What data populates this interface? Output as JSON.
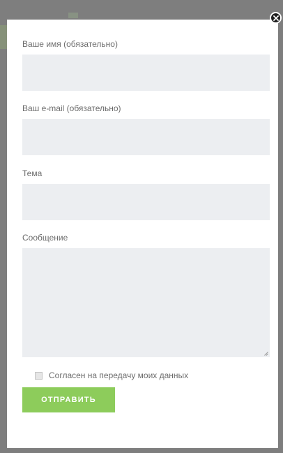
{
  "form": {
    "fields": [
      {
        "label": "Ваше имя (обязательно)",
        "value": "",
        "placeholder": ""
      },
      {
        "label": "Ваш e-mail (обязательно)",
        "value": "",
        "placeholder": ""
      },
      {
        "label": "Тема",
        "value": "",
        "placeholder": ""
      },
      {
        "label": "Сообщение",
        "value": "",
        "placeholder": ""
      }
    ],
    "consent_label": "Согласен на передачу моих данных",
    "consent_checked": false,
    "submit_label": "ОТПРАВИТЬ"
  },
  "colors": {
    "overlay": "#7e7e7e",
    "modal_bg": "#ffffff",
    "input_bg": "#eceef1",
    "submit_bg": "#8dcc5b",
    "label_text": "#6c6c6c"
  },
  "icons": {
    "close": "close-circle-icon",
    "resize": "resize-grip-icon"
  }
}
